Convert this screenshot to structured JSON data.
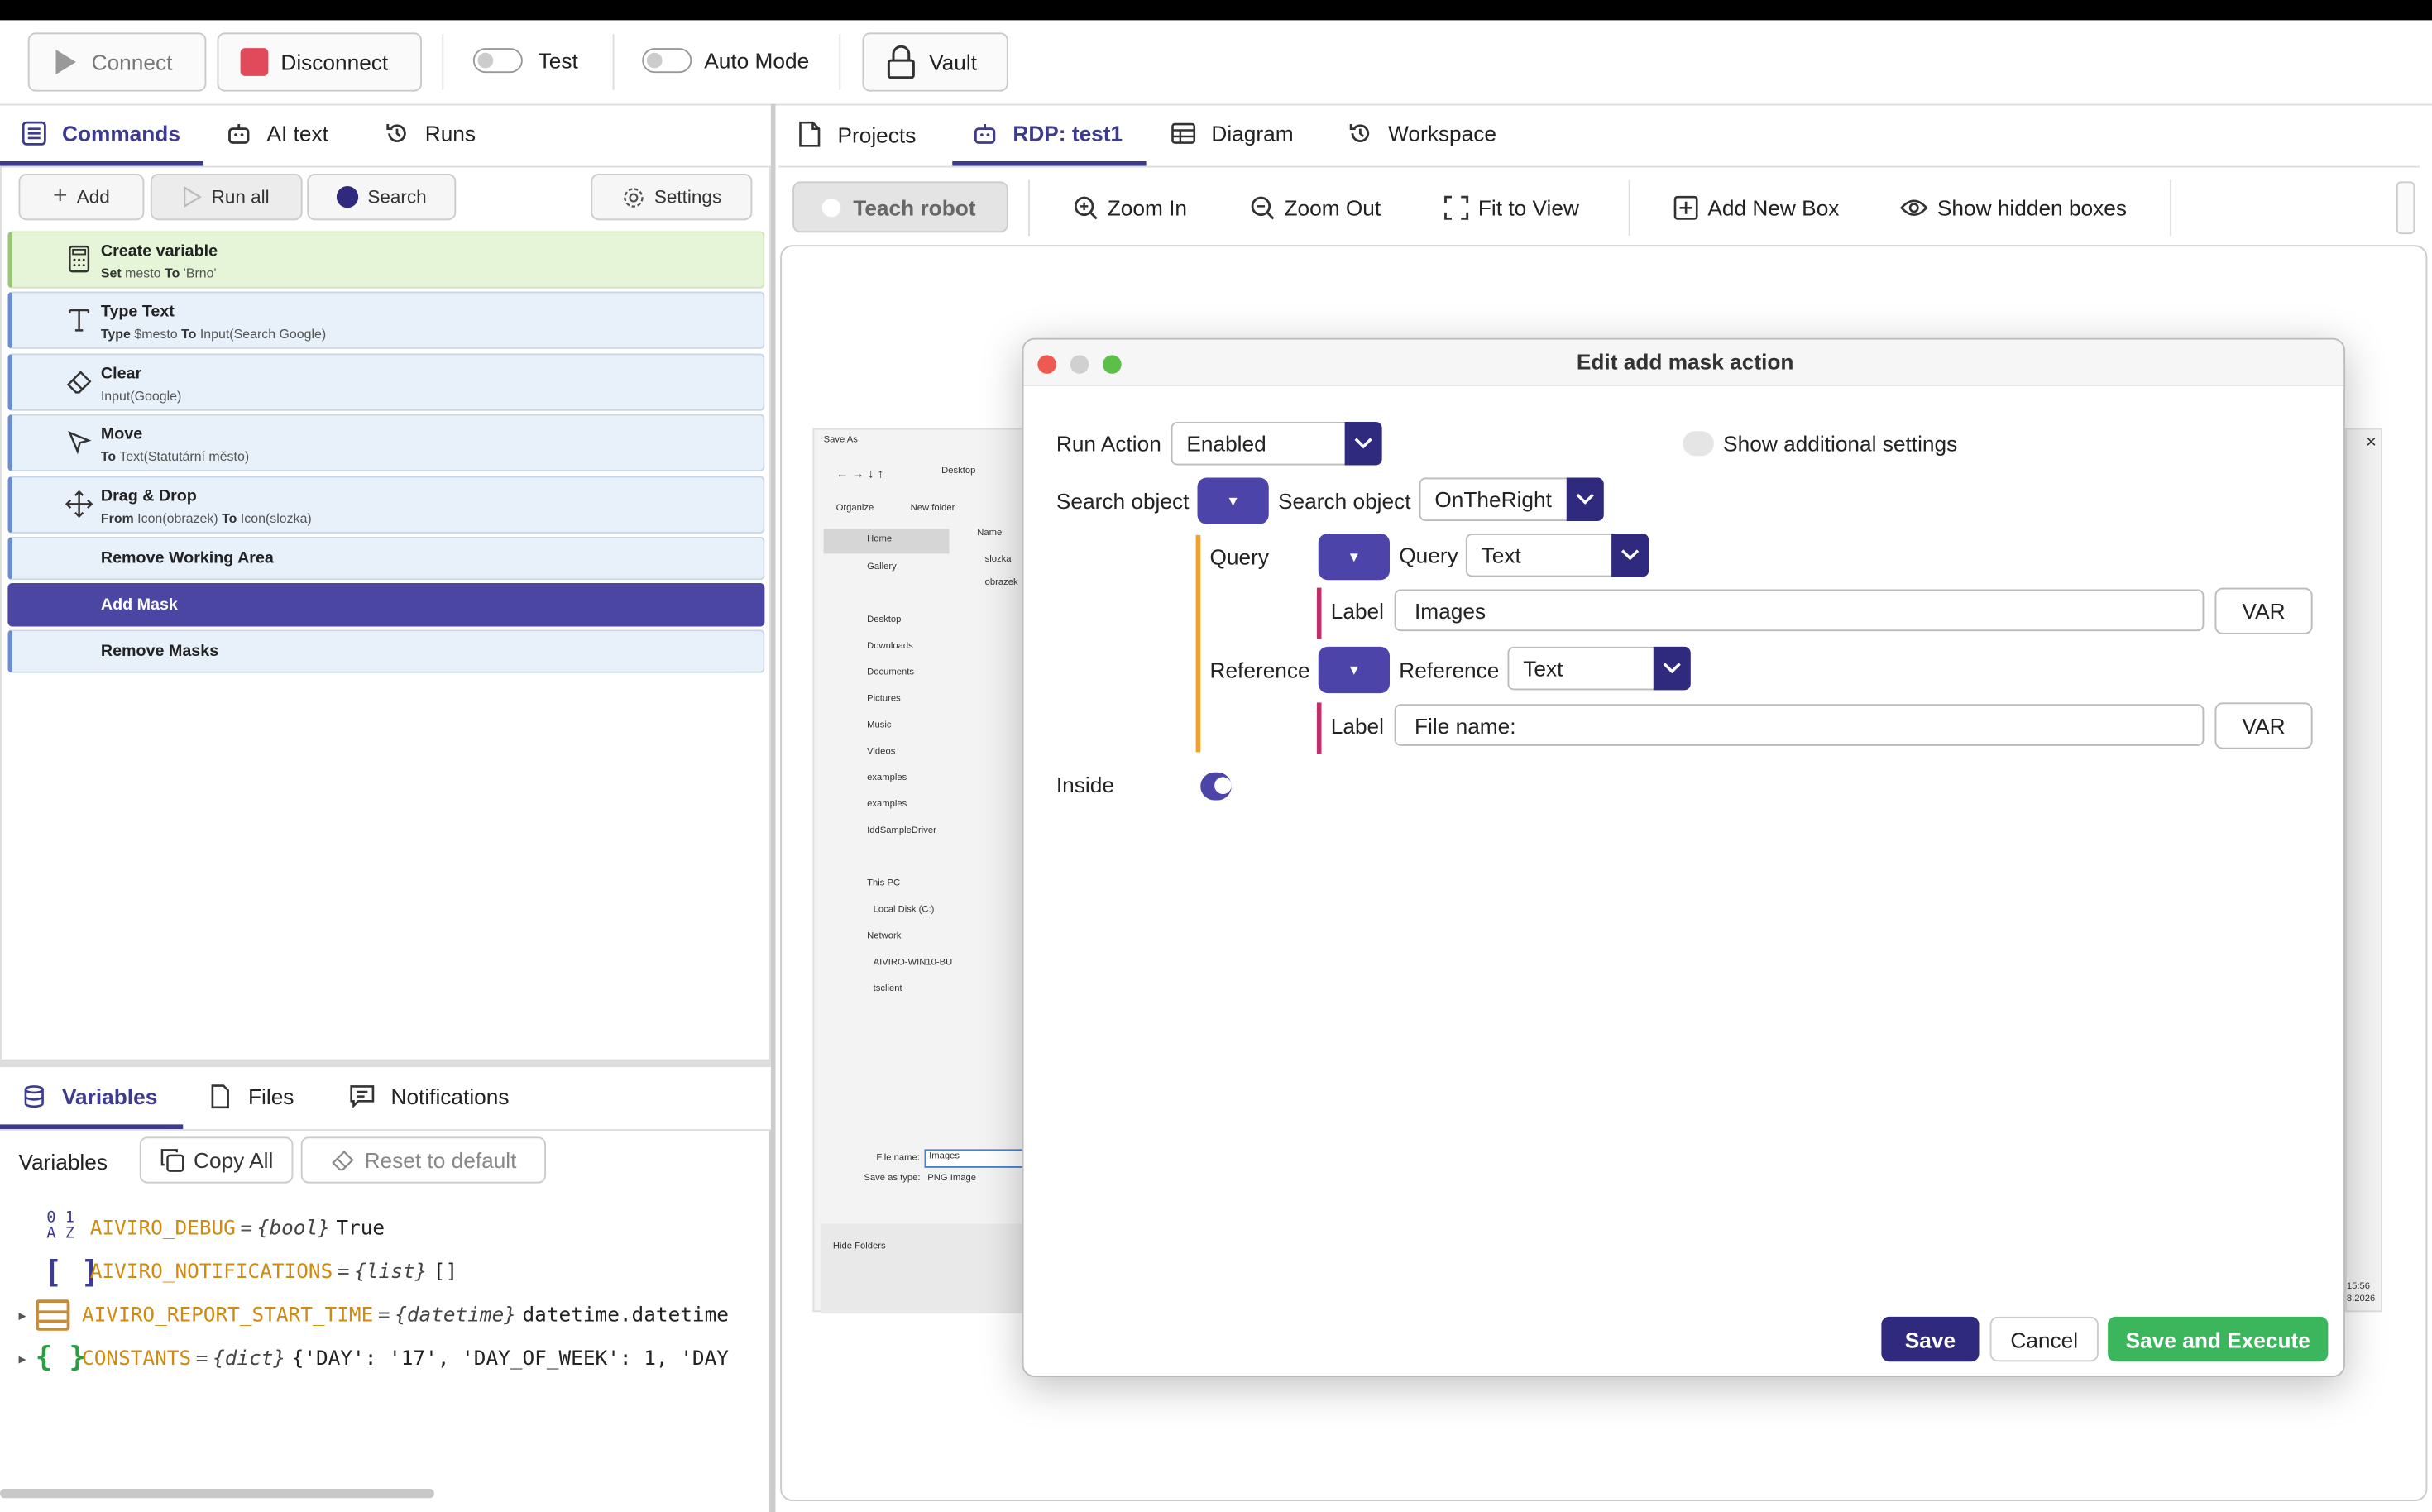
{
  "toolbar": {
    "connect": "Connect",
    "disconnect": "Disconnect",
    "test": "Test",
    "auto_mode": "Auto Mode",
    "vault": "Vault"
  },
  "left_tabs": [
    "Commands",
    "AI text",
    "Runs"
  ],
  "commands_toolbar": {
    "add": "Add",
    "run_all": "Run all",
    "search": "Search",
    "settings": "Settings"
  },
  "commands": [
    {
      "title": "Create variable",
      "k1": "Set",
      "v1": "mesto",
      "k2": "To",
      "v2": "'Brno'",
      "icon": "calculator-icon"
    },
    {
      "title": "Type Text",
      "k1": "Type",
      "v1": "$mesto",
      "k2": "To",
      "v2": "Input(Search Google)",
      "icon": "text-icon"
    },
    {
      "title": "Clear",
      "k1": "",
      "v1": "Input(Google)",
      "k2": "",
      "v2": "",
      "icon": "eraser-icon"
    },
    {
      "title": "Move",
      "k1": "To",
      "v1": "Text(Statutární město)",
      "k2": "",
      "v2": "",
      "icon": "cursor-icon"
    },
    {
      "title": "Drag & Drop",
      "k1": "From",
      "v1": "Icon(obrazek)",
      "k2": "To",
      "v2": "Icon(slozka)",
      "icon": "move-icon"
    },
    {
      "title": "Remove Working Area",
      "k1": "",
      "v1": "",
      "k2": "",
      "v2": ""
    },
    {
      "title": "Add Mask",
      "k1": "",
      "v1": "",
      "k2": "",
      "v2": ""
    },
    {
      "title": "Remove Masks",
      "k1": "",
      "v1": "",
      "k2": "",
      "v2": ""
    }
  ],
  "bottom_tabs": [
    "Variables",
    "Files",
    "Notifications"
  ],
  "variables_bar": {
    "label": "Variables",
    "copy_all": "Copy All",
    "reset": "Reset to default"
  },
  "variables": [
    {
      "icon": "0 1\nA Z",
      "name": "AIVIRO_DEBUG",
      "type": "{bool}",
      "value": "True",
      "icon_name": "bool-icon"
    },
    {
      "icon": "[ ]",
      "name": "AIVIRO_NOTIFICATIONS",
      "type": "{list}",
      "value": "[]",
      "icon_name": "list-icon"
    },
    {
      "icon": "",
      "name": "AIVIRO_REPORT_START_TIME",
      "type": "{datetime}",
      "value": "datetime.datetime",
      "icon_name": "datetime-icon"
    },
    {
      "icon": "{ }",
      "name": "CONSTANTS",
      "type": "{dict}",
      "value": "{'DAY': '17', 'DAY_OF_WEEK': 1, 'DAY",
      "icon_name": "dict-icon"
    }
  ],
  "right_tabs": [
    "Projects",
    "RDP: test1",
    "Diagram",
    "Workspace"
  ],
  "rdp_toolbar": {
    "teach": "Teach robot",
    "zoom_in": "Zoom In",
    "zoom_out": "Zoom Out",
    "fit": "Fit to View",
    "add_box": "Add New Box",
    "hidden": "Show hidden boxes"
  },
  "background_window": {
    "title": "Save As",
    "path": "Desktop",
    "organize": "Organize",
    "new_folder": "New folder",
    "name_col": "Name",
    "nav": [
      "Home",
      "Gallery",
      "Desktop",
      "Downloads",
      "Documents",
      "Pictures",
      "Music",
      "Videos",
      "examples",
      "examples",
      "IddSampleDriver",
      "This PC",
      "Local Disk (C:)",
      "Network",
      "AIVIRO-WIN10-BU",
      "tsclient"
    ],
    "files": [
      "slozka",
      "obrazek"
    ],
    "file_name_label": "File name:",
    "file_name_value": "Images",
    "save_type_label": "Save as type:",
    "save_type_value": "PNG Image",
    "hide_folders": "Hide Folders",
    "clock": "15:56",
    "date": "8.2026"
  },
  "dialog": {
    "title": "Edit add mask action",
    "run_action_label": "Run Action",
    "run_action_value": "Enabled",
    "show_additional": "Show additional settings",
    "search_object_label": "Search object",
    "search_object_label2": "Search object",
    "search_object_value": "OnTheRight",
    "query_label": "Query",
    "query_label2": "Query",
    "query_value": "Text",
    "label1": "Label",
    "label1_value": "Images",
    "var1": "VAR",
    "reference_label": "Reference",
    "reference_label2": "Reference",
    "reference_value": "Text",
    "label2": "Label",
    "label2_value": "File name:",
    "var2": "VAR",
    "inside_label": "Inside",
    "save": "Save",
    "cancel": "Cancel",
    "save_execute": "Save and Execute"
  },
  "colors": {
    "accent": "#3d3b8e",
    "save": "#2f2a7e",
    "save_execute": "#3cb65c",
    "disconnect": "#e04a5a",
    "selected_row": "#4b46a3"
  }
}
